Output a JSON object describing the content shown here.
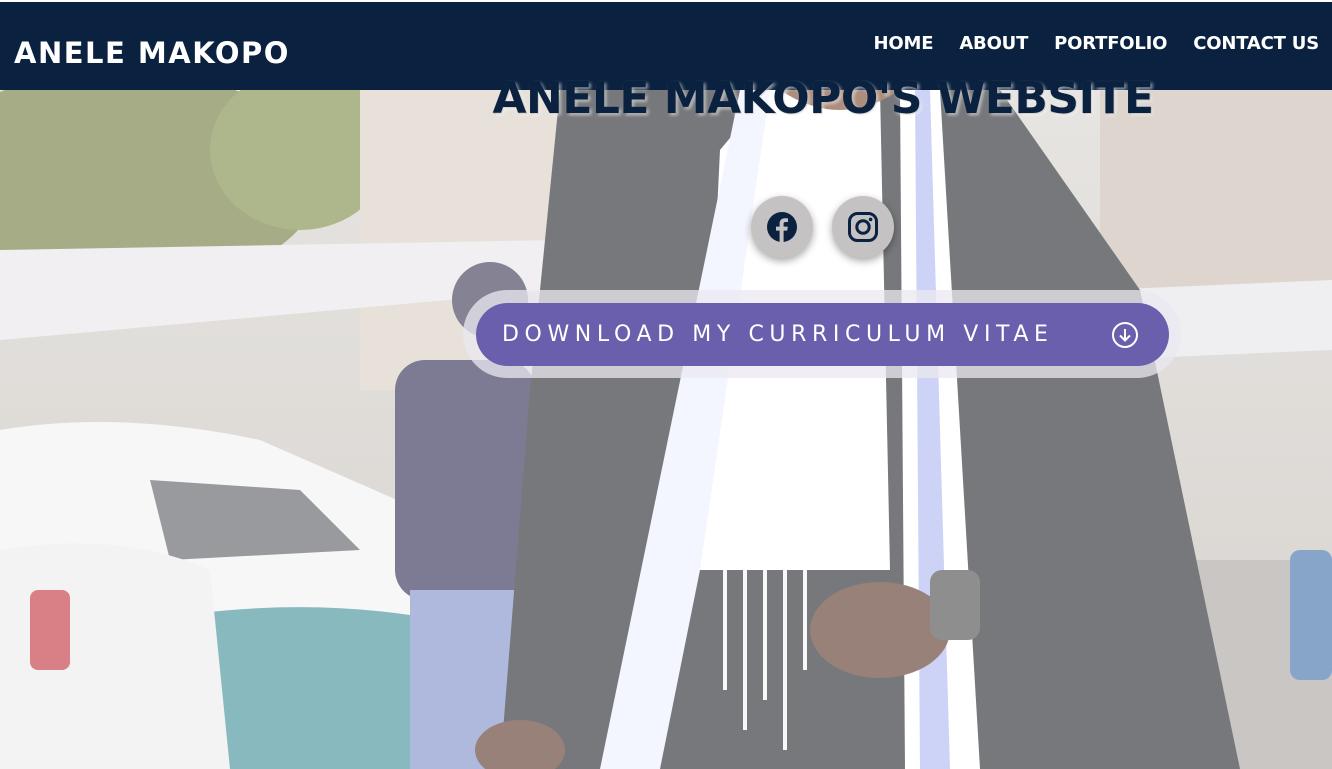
{
  "header": {
    "brand": "ANELE MAKOPO",
    "nav": [
      {
        "label": "HOME"
      },
      {
        "label": "ABOUT"
      },
      {
        "label": "PORTFOLIO"
      },
      {
        "label": "CONTACT US"
      }
    ]
  },
  "hero": {
    "title": "ANELE MAKOPO'S WEBSITE",
    "social": [
      {
        "icon": "facebook-icon"
      },
      {
        "icon": "instagram-icon"
      }
    ],
    "cv_button": {
      "label": "DOWNLOAD MY CURRICULUM VITAE",
      "icon": "download-circle-icon"
    }
  },
  "colors": {
    "navbar": "#0a2240",
    "title": "#0a2240",
    "button": "#6a5fad",
    "social_bg": "#c5c2c4"
  }
}
